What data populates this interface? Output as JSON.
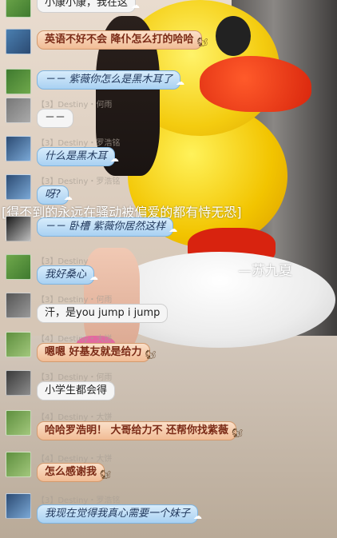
{
  "overlay_text": "[得不到的永远在骚动被偏爱的都有恃无恐]",
  "signature": "—苏九夏",
  "colors": {
    "blue_bubble": "#a9d1f2",
    "orange_bubble": "#f1bc95",
    "white_bubble": "#f5f5f5"
  },
  "messages": [
    {
      "meta": "",
      "text": "小康小康，我在这",
      "style": "white",
      "icon": "cloud-icon"
    },
    {
      "meta": "",
      "text": "英语不好不会 降仆怎么打的哈哈",
      "style": "orange",
      "icon": "squirrel-icon"
    },
    {
      "meta": "",
      "text": "－－ 紫薇你怎么是黑木耳了",
      "style": "blue",
      "icon": "cloud-icon"
    },
    {
      "meta": "【3】Destiny・何雨",
      "text": "－－",
      "style": "white",
      "icon": ""
    },
    {
      "meta": "【3】Destiny・罗浩铭",
      "text": "什么是黑木耳",
      "style": "blue",
      "icon": "cloud-icon"
    },
    {
      "meta": "【3】Destiny・罗浩铭",
      "text": "呀?",
      "style": "blue",
      "icon": "cloud-icon"
    },
    {
      "meta": "",
      "text": "－－ 卧槽 紫薇你居然这样",
      "style": "blue",
      "icon": "cloud-icon"
    },
    {
      "meta": "【3】Destiny",
      "text": "我好桑心",
      "style": "blue",
      "icon": "cloud-icon"
    },
    {
      "meta": "【3】Destiny・何雨",
      "text": "汗，是you jump i  jump",
      "style": "white",
      "icon": ""
    },
    {
      "meta": "【4】Destiny・大饼",
      "text": "嗯嗯 好基友就是给力",
      "style": "orange",
      "icon": "squirrel-icon"
    },
    {
      "meta": "【3】Destiny・何雨",
      "text": "小学生都会得",
      "style": "white",
      "icon": ""
    },
    {
      "meta": "【4】Destiny・大饼",
      "text": "哈哈罗浩明！ 大哥给力不 还帮你找紫薇",
      "style": "orange",
      "icon": "squirrel-icon"
    },
    {
      "meta": "【4】Destiny・大饼",
      "text": "怎么感谢我",
      "style": "orange",
      "icon": "squirrel-icon"
    },
    {
      "meta": "【3】Destiny・罗浩铭",
      "text": "我现在觉得我真心需要一个妹子",
      "style": "blue",
      "icon": "cloud-icon"
    }
  ]
}
